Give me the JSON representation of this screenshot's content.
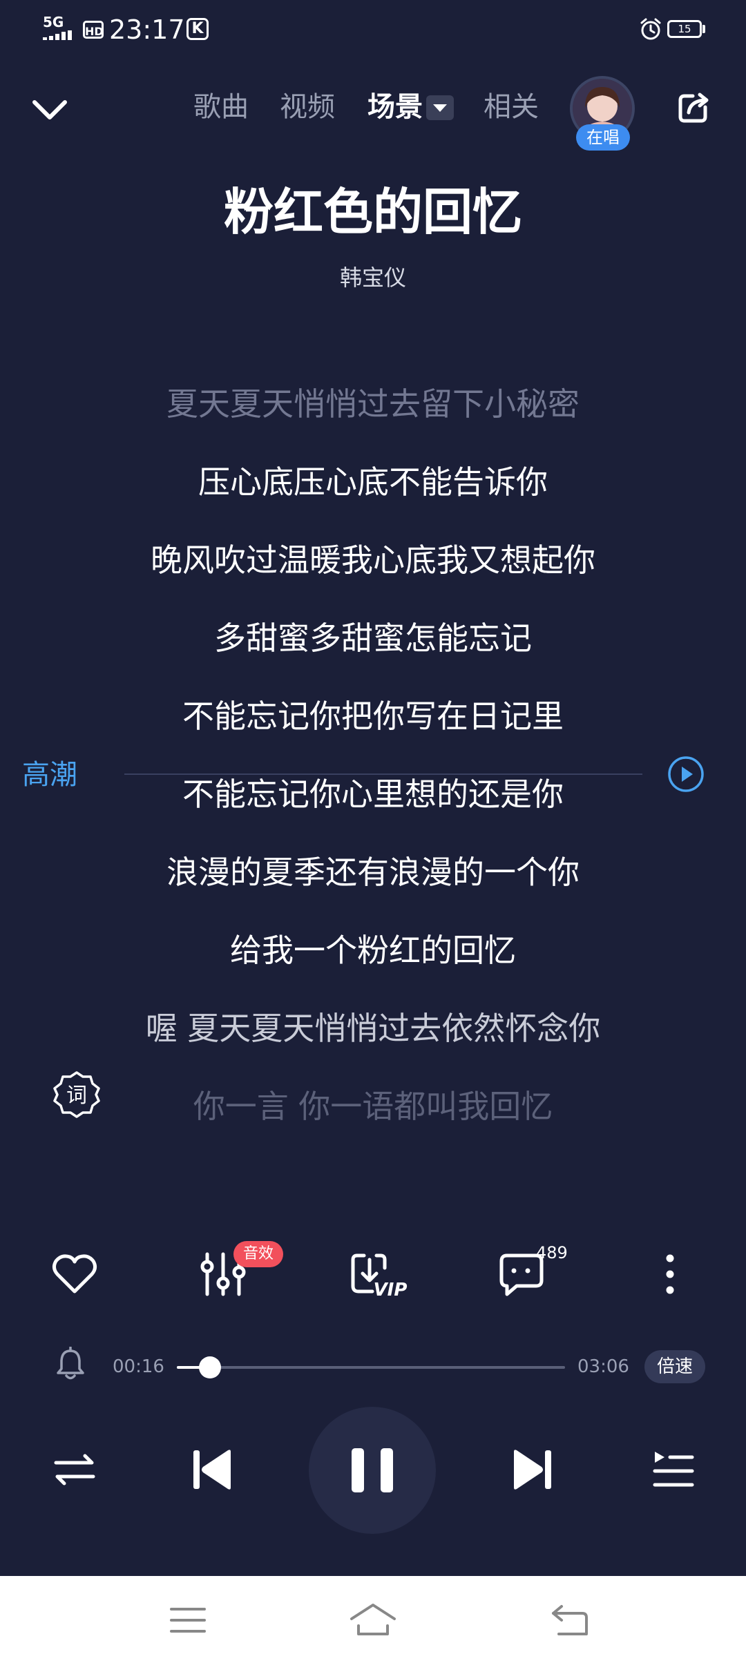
{
  "status_bar": {
    "signal": "5G",
    "hd": "HD",
    "time": "23:17",
    "app_icon": "K",
    "battery": "15"
  },
  "header": {
    "tabs": [
      {
        "label": "歌曲"
      },
      {
        "label": "视频"
      },
      {
        "label": "场景"
      },
      {
        "label": "相关"
      }
    ],
    "active_tab": "场景",
    "singing_badge": "在唱"
  },
  "song": {
    "title": "粉红色的回忆",
    "artist": "韩宝仪"
  },
  "lyrics": [
    "夏天夏天悄悄过去留下小秘密",
    "压心底压心底不能告诉你",
    "晚风吹过温暖我心底我又想起你",
    "多甜蜜多甜蜜怎能忘记",
    "不能忘记你把你写在日记里",
    "不能忘记你心里想的还是你",
    "浪漫的夏季还有浪漫的一个你",
    "给我一个粉红的回忆",
    "喔 夏天夏天悄悄过去依然怀念你",
    "你一言 你一语都叫我回忆"
  ],
  "climax_label": "高潮",
  "lyric_button": "词",
  "actions": {
    "sound_effect_badge": "音效",
    "download_vip": "VIP",
    "comment_count": "489"
  },
  "progress": {
    "current": "00:16",
    "duration": "03:06",
    "fraction": 0.086,
    "speed_label": "倍速"
  },
  "colors": {
    "background": "#1b1f38",
    "accent_blue": "#4aa3f0",
    "badge_red": "#f2505c"
  }
}
